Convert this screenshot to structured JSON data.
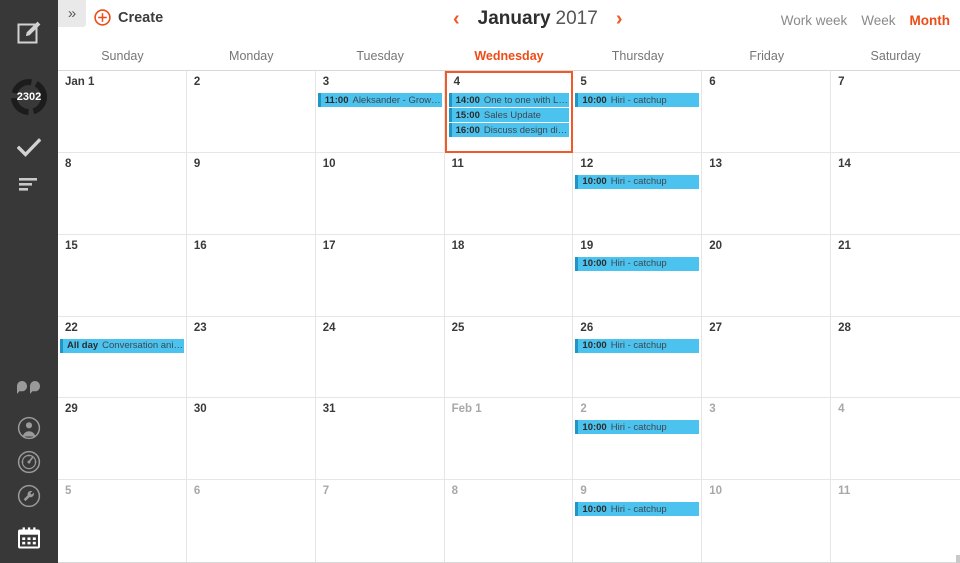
{
  "sidebar": {
    "compose_icon": "compose-icon",
    "badge_count": "2302",
    "icons": [
      {
        "name": "compose-icon"
      },
      {
        "name": "unread-count-ring"
      },
      {
        "name": "check-icon"
      },
      {
        "name": "list-icon"
      },
      {
        "name": "people-icon"
      },
      {
        "name": "contact-circle-icon"
      },
      {
        "name": "speedometer-icon"
      },
      {
        "name": "wrench-icon"
      },
      {
        "name": "calendar-icon"
      }
    ]
  },
  "toolbar": {
    "expand_label": "»",
    "create_label": "Create",
    "prev_label": "‹",
    "next_label": "›",
    "month": "January",
    "year": "2017",
    "views": [
      {
        "label": "Work week",
        "active": false
      },
      {
        "label": "Week",
        "active": false
      },
      {
        "label": "Month",
        "active": true
      }
    ]
  },
  "weekdays": [
    {
      "label": "Sunday",
      "today": false
    },
    {
      "label": "Monday",
      "today": false
    },
    {
      "label": "Tuesday",
      "today": false
    },
    {
      "label": "Wednesday",
      "today": true
    },
    {
      "label": "Thursday",
      "today": false
    },
    {
      "label": "Friday",
      "today": false
    },
    {
      "label": "Saturday",
      "today": false
    }
  ],
  "colors": {
    "accent": "#ef4b16",
    "today_border": "#ef5a28",
    "event_bg": "#4cc3ee",
    "event_bar": "#2096c4",
    "sidebar_bg": "#383838"
  },
  "cells": [
    {
      "day": "Jan 1",
      "other": false,
      "today": false,
      "events": []
    },
    {
      "day": "2",
      "other": false,
      "today": false,
      "events": []
    },
    {
      "day": "3",
      "other": false,
      "today": false,
      "events": [
        {
          "time": "11:00",
          "title": "Aleksander - Growth..."
        }
      ]
    },
    {
      "day": "4",
      "other": false,
      "today": true,
      "events": [
        {
          "time": "14:00",
          "title": "One to one with Luka"
        },
        {
          "time": "15:00",
          "title": "Sales Update"
        },
        {
          "time": "16:00",
          "title": "Discuss design direc..."
        }
      ]
    },
    {
      "day": "5",
      "other": false,
      "today": false,
      "events": [
        {
          "time": "10:00",
          "title": "Hiri - catchup"
        }
      ]
    },
    {
      "day": "6",
      "other": false,
      "today": false,
      "events": []
    },
    {
      "day": "7",
      "other": false,
      "today": false,
      "events": []
    },
    {
      "day": "8",
      "other": false,
      "today": false,
      "events": []
    },
    {
      "day": "9",
      "other": false,
      "today": false,
      "events": []
    },
    {
      "day": "10",
      "other": false,
      "today": false,
      "events": []
    },
    {
      "day": "11",
      "other": false,
      "today": false,
      "events": []
    },
    {
      "day": "12",
      "other": false,
      "today": false,
      "events": [
        {
          "time": "10:00",
          "title": "Hiri - catchup"
        }
      ]
    },
    {
      "day": "13",
      "other": false,
      "today": false,
      "events": []
    },
    {
      "day": "14",
      "other": false,
      "today": false,
      "events": []
    },
    {
      "day": "15",
      "other": false,
      "today": false,
      "events": []
    },
    {
      "day": "16",
      "other": false,
      "today": false,
      "events": []
    },
    {
      "day": "17",
      "other": false,
      "today": false,
      "events": []
    },
    {
      "day": "18",
      "other": false,
      "today": false,
      "events": []
    },
    {
      "day": "19",
      "other": false,
      "today": false,
      "events": [
        {
          "time": "10:00",
          "title": "Hiri - catchup"
        }
      ]
    },
    {
      "day": "20",
      "other": false,
      "today": false,
      "events": []
    },
    {
      "day": "21",
      "other": false,
      "today": false,
      "events": []
    },
    {
      "day": "22",
      "other": false,
      "today": false,
      "events": [
        {
          "time": "All day",
          "title": "Conversation anim..."
        }
      ]
    },
    {
      "day": "23",
      "other": false,
      "today": false,
      "events": []
    },
    {
      "day": "24",
      "other": false,
      "today": false,
      "events": []
    },
    {
      "day": "25",
      "other": false,
      "today": false,
      "events": []
    },
    {
      "day": "26",
      "other": false,
      "today": false,
      "events": [
        {
          "time": "10:00",
          "title": "Hiri - catchup"
        }
      ]
    },
    {
      "day": "27",
      "other": false,
      "today": false,
      "events": []
    },
    {
      "day": "28",
      "other": false,
      "today": false,
      "events": []
    },
    {
      "day": "29",
      "other": false,
      "today": false,
      "events": []
    },
    {
      "day": "30",
      "other": false,
      "today": false,
      "events": []
    },
    {
      "day": "31",
      "other": false,
      "today": false,
      "events": []
    },
    {
      "day": "Feb 1",
      "other": true,
      "today": false,
      "events": []
    },
    {
      "day": "2",
      "other": true,
      "today": false,
      "events": [
        {
          "time": "10:00",
          "title": "Hiri - catchup"
        }
      ]
    },
    {
      "day": "3",
      "other": true,
      "today": false,
      "events": []
    },
    {
      "day": "4",
      "other": true,
      "today": false,
      "events": []
    },
    {
      "day": "5",
      "other": true,
      "today": false,
      "events": []
    },
    {
      "day": "6",
      "other": true,
      "today": false,
      "events": []
    },
    {
      "day": "7",
      "other": true,
      "today": false,
      "events": []
    },
    {
      "day": "8",
      "other": true,
      "today": false,
      "events": []
    },
    {
      "day": "9",
      "other": true,
      "today": false,
      "events": [
        {
          "time": "10:00",
          "title": "Hiri - catchup"
        }
      ]
    },
    {
      "day": "10",
      "other": true,
      "today": false,
      "events": []
    },
    {
      "day": "11",
      "other": true,
      "today": false,
      "events": []
    }
  ]
}
